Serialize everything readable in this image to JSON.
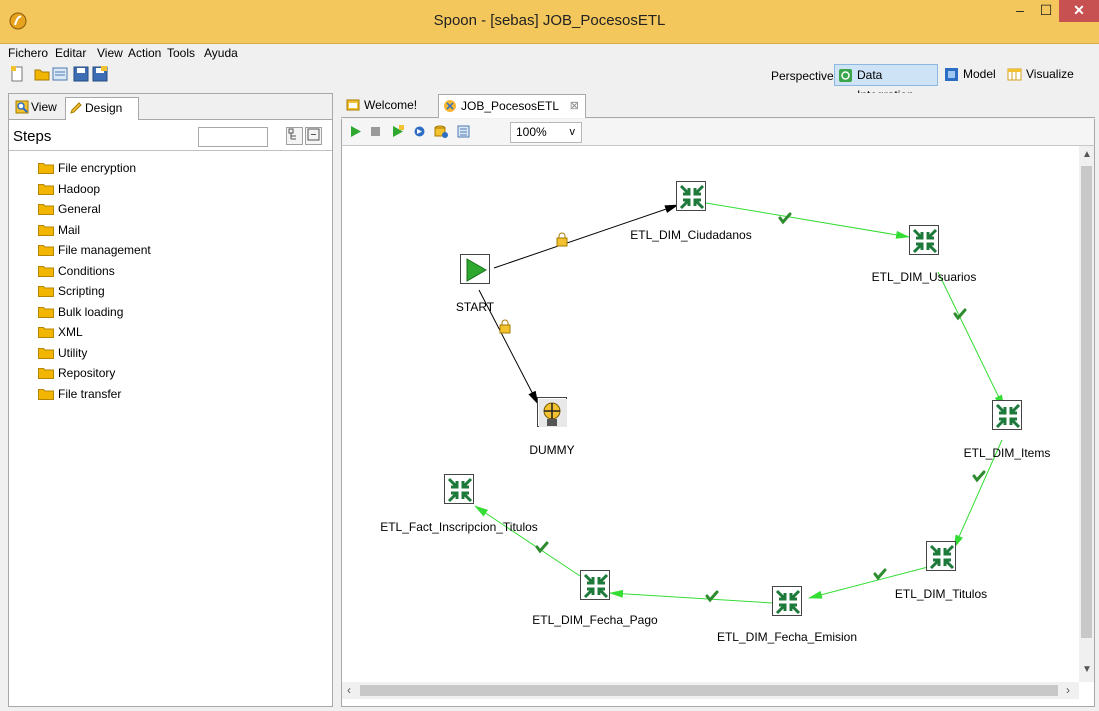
{
  "window": {
    "title": "Spoon - [sebas] JOB_PocesosETL",
    "app_icon": "spoon-logo-icon",
    "controls": {
      "minimize": "–",
      "maximize": "☐",
      "close": "✕"
    }
  },
  "menubar": [
    "Fichero",
    "Editar",
    "View",
    "Action",
    "Tools",
    "Ayuda"
  ],
  "toolbar": {
    "perspective_label": "Perspective:",
    "perspectives": [
      {
        "label": "Data Integration",
        "icon": "data-integration-icon",
        "active": true
      },
      {
        "label": "Model",
        "icon": "model-icon",
        "active": false
      },
      {
        "label": "Visualize",
        "icon": "visualize-icon",
        "active": false
      }
    ]
  },
  "left_panel": {
    "tabs": [
      {
        "label": "View",
        "icon": "view-icon",
        "active": false
      },
      {
        "label": "Design",
        "icon": "pencil-icon",
        "active": true
      }
    ],
    "steps_title": "Steps",
    "search_value": "",
    "categories": [
      "File encryption",
      "Hadoop",
      "General",
      "Mail",
      "File management",
      "Conditions",
      "Scripting",
      "Bulk loading",
      "XML",
      "Utility",
      "Repository",
      "File transfer"
    ]
  },
  "editor": {
    "tabs": [
      {
        "label": "Welcome!",
        "icon": "welcome-icon",
        "active": false
      },
      {
        "label": "JOB_PocesosETL",
        "icon": "job-icon",
        "active": true,
        "close": "⊠"
      }
    ],
    "zoom": "100%",
    "zoom_arrow": "v"
  },
  "job": {
    "start_label": "START",
    "dummy_label": "DUMMY",
    "entries": [
      "ETL_DIM_Ciudadanos",
      "ETL_DIM_Usuarios",
      "ETL_DIM_Items",
      "ETL_DIM_Titulos",
      "ETL_DIM_Fecha_Emision",
      "ETL_DIM_Fecha_Pago",
      "ETL_Fact_Inscripcion_Titulos"
    ]
  },
  "colors": {
    "titlebar": "#f3c75c",
    "hop_success": "#33dd33",
    "hop_unconditional": "#000000",
    "transformation_icon": "#1e7a3a",
    "start_icon": "#2ea82e",
    "folder": "#f2b600"
  }
}
